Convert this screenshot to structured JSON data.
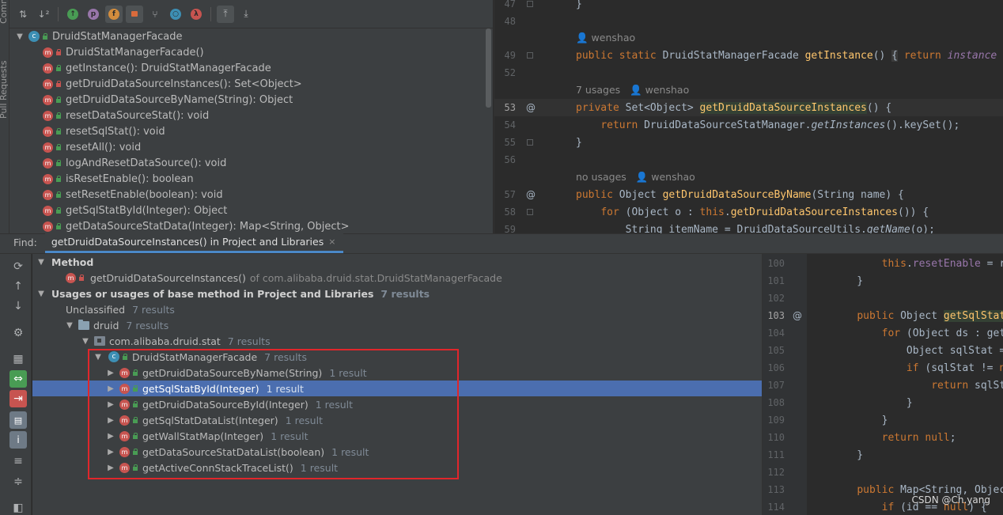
{
  "side_strip": {
    "labels": [
      "Commit",
      "Pull Requests"
    ]
  },
  "structure": {
    "toolbar_icons": [
      "sort-alpha-icon",
      "sort-visibility-icon",
      "show-inherited-icon",
      "show-properties-icon",
      "show-fields-icon",
      "show-non-public-icon",
      "show-lambdas-icon",
      "show-anonymous-icon",
      "autoscroll-to-source-icon",
      "autoscroll-from-source-icon"
    ],
    "class_name": "DruidStatManagerFacade",
    "members": [
      {
        "label": "DruidStatManagerFacade()",
        "vis": "private"
      },
      {
        "label": "getInstance(): DruidStatManagerFacade",
        "vis": "public"
      },
      {
        "label": "getDruidDataSourceInstances(): Set<Object>",
        "vis": "private"
      },
      {
        "label": "getDruidDataSourceByName(String): Object",
        "vis": "public"
      },
      {
        "label": "resetDataSourceStat(): void",
        "vis": "public"
      },
      {
        "label": "resetSqlStat(): void",
        "vis": "public"
      },
      {
        "label": "resetAll(): void",
        "vis": "public"
      },
      {
        "label": "logAndResetDataSource(): void",
        "vis": "public"
      },
      {
        "label": "isResetEnable(): boolean",
        "vis": "public"
      },
      {
        "label": "setResetEnable(boolean): void",
        "vis": "public"
      },
      {
        "label": "getSqlStatById(Integer): Object",
        "vis": "public"
      },
      {
        "label": "getDataSourceStatData(Integer): Map<String, Object>",
        "vis": "public"
      }
    ]
  },
  "editor_top": {
    "lines": [
      {
        "num": "47",
        "text": "}"
      },
      {
        "num": "48",
        "text": ""
      },
      {
        "num": "49",
        "text": "public static DruidStatManagerFacade getInstance() { return instance"
      },
      {
        "num": "52",
        "text": ""
      },
      {
        "num": "53",
        "text": "private Set<Object> getDruidDataSourceInstances() {"
      },
      {
        "num": "54",
        "text": "    return DruidDataSourceStatManager.getInstances().keySet();"
      },
      {
        "num": "55",
        "text": "}"
      },
      {
        "num": "56",
        "text": ""
      },
      {
        "num": "57",
        "text": "public Object getDruidDataSourceByName(String name) {"
      },
      {
        "num": "58",
        "text": "    for (Object o : this.getDruidDataSourceInstances()) {"
      },
      {
        "num": "59",
        "text": "        String itemName = DruidDataSourceUtils.getName(o);"
      }
    ],
    "hints": {
      "author1": "wenshao",
      "usages2": "7 usages",
      "author2": "wenshao",
      "usages3": "no usages",
      "author3": "wenshao"
    }
  },
  "find": {
    "label": "Find:",
    "tab_title": "getDruidDataSourceInstances() in Project and Libraries",
    "tab_close": "×",
    "toolbar_icons": [
      "rerun-icon",
      "prev-occurrence-icon",
      "next-occurrence-icon",
      "settings-icon",
      "group-by-module-icon",
      "navigate-usage-icon",
      "exclude-icon",
      "group-by-package-icon",
      "info-icon",
      "expand-all-icon",
      "collapse-all-icon",
      "preview-icon"
    ],
    "method_header": "Method",
    "method_sig": "getDruidDataSourceInstances()",
    "method_of": "of com.alibaba.druid.stat.DruidStatManagerFacade",
    "usages_header": "Usages or usages of base method in Project and Libraries",
    "usages_count": "7 results",
    "unclassified": "Unclassified",
    "unclassified_count": "7 results",
    "module": "druid",
    "module_count": "7 results",
    "package": "com.alibaba.druid.stat",
    "package_count": "7 results",
    "class_name": "DruidStatManagerFacade",
    "class_count": "7 results",
    "results": [
      {
        "method": "getDruidDataSourceByName(String)",
        "count": "1 result",
        "selected": false
      },
      {
        "method": "getSqlStatById(Integer)",
        "count": "1 result",
        "selected": true
      },
      {
        "method": "getDruidDataSourceById(Integer)",
        "count": "1 result",
        "selected": false
      },
      {
        "method": "getSqlStatDataList(Integer)",
        "count": "1 result",
        "selected": false
      },
      {
        "method": "getWallStatMap(Integer)",
        "count": "1 result",
        "selected": false
      },
      {
        "method": "getDataSourceStatDataList(boolean)",
        "count": "1 result",
        "selected": false
      },
      {
        "method": "getActiveConnStackTraceList()",
        "count": "1 result",
        "selected": false
      }
    ]
  },
  "preview": {
    "lines": [
      {
        "num": "100",
        "text": "        this.resetEnable = rese"
      },
      {
        "num": "101",
        "text": "    }"
      },
      {
        "num": "102",
        "text": ""
      },
      {
        "num": "103",
        "text": "    public Object getSqlStatByI"
      },
      {
        "num": "104",
        "text": "        for (Object ds : getDru"
      },
      {
        "num": "105",
        "text": "            Object sqlStat = Dr"
      },
      {
        "num": "106",
        "text": "            if (sqlStat != null"
      },
      {
        "num": "107",
        "text": "                return sqlStat;"
      },
      {
        "num": "108",
        "text": "            }"
      },
      {
        "num": "109",
        "text": "        }"
      },
      {
        "num": "110",
        "text": "        return null;"
      },
      {
        "num": "111",
        "text": "    }"
      },
      {
        "num": "112",
        "text": ""
      },
      {
        "num": "113",
        "text": "    public Map<String, Object> "
      },
      {
        "num": "114",
        "text": "        if (id == null) {"
      }
    ]
  },
  "watermark": "CSDN @Ch.yang",
  "colors": {
    "selection": "#4b6eaf",
    "highlight_box": "#e0262b",
    "keyword": "#cc7832",
    "function": "#ffc66d"
  }
}
